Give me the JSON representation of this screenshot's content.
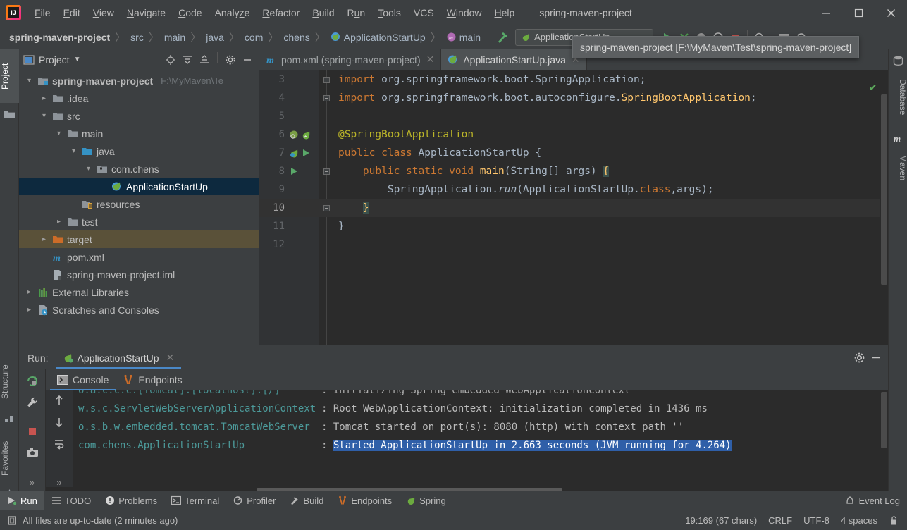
{
  "window": {
    "title": "spring-maven-project",
    "tooltip": "spring-maven-project [F:\\MyMaven\\Test\\spring-maven-project]",
    "minimize": "—",
    "maximize": "❐",
    "close": "✕"
  },
  "menu": [
    {
      "label": "File",
      "mnemonic": "F"
    },
    {
      "label": "Edit",
      "mnemonic": "E"
    },
    {
      "label": "View",
      "mnemonic": "V"
    },
    {
      "label": "Navigate",
      "mnemonic": "N"
    },
    {
      "label": "Code",
      "mnemonic": "C"
    },
    {
      "label": "Analyze",
      "mnemonic": "z"
    },
    {
      "label": "Refactor",
      "mnemonic": "R"
    },
    {
      "label": "Build",
      "mnemonic": "B"
    },
    {
      "label": "Run",
      "mnemonic": "u"
    },
    {
      "label": "Tools",
      "mnemonic": "T"
    },
    {
      "label": "VCS",
      "mnemonic": ""
    },
    {
      "label": "Window",
      "mnemonic": "W"
    },
    {
      "label": "Help",
      "mnemonic": "H"
    }
  ],
  "breadcrumbs": [
    {
      "label": "spring-maven-project",
      "bold": true,
      "icon": "none"
    },
    {
      "label": "src",
      "bold": false,
      "icon": "none"
    },
    {
      "label": "main",
      "bold": false,
      "icon": "none"
    },
    {
      "label": "java",
      "bold": false,
      "icon": "none"
    },
    {
      "label": "com",
      "bold": false,
      "icon": "none"
    },
    {
      "label": "chens",
      "bold": false,
      "icon": "none"
    },
    {
      "label": "ApplicationStartUp",
      "bold": false,
      "icon": "spring-class-icon"
    },
    {
      "label": "main",
      "bold": false,
      "icon": "method-icon"
    }
  ],
  "toolbar": {
    "build_icon": "hammer-icon",
    "run_config_name": "ApplicationStartUp",
    "actions": [
      "run-icon",
      "debug-icon",
      "run-coverage-icon",
      "profile-icon",
      "stop-icon",
      "search-icon",
      "layout-icon",
      "settings-icon"
    ]
  },
  "left_strip": [
    {
      "label": "Project",
      "icon": "folder-icon",
      "selected": true
    },
    {
      "label": "Structure",
      "icon": "structure-icon",
      "selected": false
    },
    {
      "label": "Favorites",
      "icon": "star-icon",
      "selected": false
    }
  ],
  "right_strip": [
    {
      "label": "Database",
      "icon": "database-icon"
    },
    {
      "label": "Maven",
      "icon": "maven-icon"
    }
  ],
  "project_panel": {
    "title": "Project",
    "dropdown_icon": "chevron-down-icon",
    "actions": [
      "locate-icon",
      "expand-all-icon",
      "collapse-all-icon",
      "gear-icon",
      "hide-icon"
    ],
    "tree": [
      {
        "label": "spring-maven-project",
        "path": "F:\\MyMaven\\Te",
        "depth": 0,
        "arrow": "down",
        "icon": "module-icon",
        "bold": true,
        "state": "normal"
      },
      {
        "label": ".idea",
        "path": "",
        "depth": 1,
        "arrow": "right",
        "icon": "folder-icon",
        "bold": false,
        "state": "normal"
      },
      {
        "label": "src",
        "path": "",
        "depth": 1,
        "arrow": "down",
        "icon": "folder-icon",
        "bold": false,
        "state": "normal"
      },
      {
        "label": "main",
        "path": "",
        "depth": 2,
        "arrow": "down",
        "icon": "folder-icon",
        "bold": false,
        "state": "normal"
      },
      {
        "label": "java",
        "path": "",
        "depth": 3,
        "arrow": "down",
        "icon": "source-icon",
        "bold": false,
        "state": "normal"
      },
      {
        "label": "com.chens",
        "path": "",
        "depth": 4,
        "arrow": "down",
        "icon": "package-icon",
        "bold": false,
        "state": "normal"
      },
      {
        "label": "ApplicationStartUp",
        "path": "",
        "depth": 5,
        "arrow": "none",
        "icon": "spring-class-icon",
        "bold": false,
        "state": "selected"
      },
      {
        "label": "resources",
        "path": "",
        "depth": 3,
        "arrow": "none",
        "icon": "resource-icon",
        "bold": false,
        "state": "normal"
      },
      {
        "label": "test",
        "path": "",
        "depth": 2,
        "arrow": "right",
        "icon": "folder-icon",
        "bold": false,
        "state": "normal"
      },
      {
        "label": "target",
        "path": "",
        "depth": 1,
        "arrow": "right",
        "icon": "target-icon",
        "bold": false,
        "state": "highlight"
      },
      {
        "label": "pom.xml",
        "path": "",
        "depth": 1,
        "arrow": "none",
        "icon": "maven-file-icon",
        "bold": false,
        "state": "normal"
      },
      {
        "label": "spring-maven-project.iml",
        "path": "",
        "depth": 1,
        "arrow": "none",
        "icon": "iml-icon",
        "bold": false,
        "state": "normal"
      },
      {
        "label": "External Libraries",
        "path": "",
        "depth": 0,
        "arrow": "right",
        "icon": "library-icon",
        "bold": false,
        "state": "normal"
      },
      {
        "label": "Scratches and Consoles",
        "path": "",
        "depth": 0,
        "arrow": "right",
        "icon": "scratch-icon",
        "bold": false,
        "state": "normal"
      }
    ]
  },
  "editor": {
    "tabs": [
      {
        "label": "pom.xml (spring-maven-project)",
        "icon": "maven-file-icon",
        "active": false,
        "close": "✕"
      },
      {
        "label": "ApplicationStartUp.java",
        "icon": "spring-class-icon",
        "active": true,
        "close": "✕"
      }
    ],
    "inspection_status": "✔",
    "lines": [
      {
        "num": "3",
        "current": false,
        "fold": "collapse",
        "gutter": [],
        "tokens": [
          {
            "t": "import ",
            "c": "kw"
          },
          {
            "t": "org.springframework.boot.SpringApplication",
            "c": "cls"
          },
          {
            "t": ";",
            "c": "br"
          }
        ]
      },
      {
        "num": "4",
        "current": false,
        "fold": "collapse",
        "gutter": [],
        "tokens": [
          {
            "t": "import ",
            "c": "kw"
          },
          {
            "t": "org.springframework.boot.autoconfigure.",
            "c": "cls"
          },
          {
            "t": "SpringBootApplication",
            "c": "fn"
          },
          {
            "t": ";",
            "c": "br"
          }
        ]
      },
      {
        "num": "5",
        "current": false,
        "fold": "none",
        "gutter": [],
        "tokens": []
      },
      {
        "num": "6",
        "current": false,
        "fold": "none",
        "gutter": [
          "bean-icon",
          "spring-leaf-icon"
        ],
        "tokens": [
          {
            "t": "@SpringBootApplication",
            "c": "ann"
          }
        ]
      },
      {
        "num": "7",
        "current": false,
        "fold": "none",
        "gutter": [
          "spring-bean-icon",
          "run-gutter-icon"
        ],
        "tokens": [
          {
            "t": "public class ",
            "c": "kw"
          },
          {
            "t": "ApplicationStartUp",
            "c": "cls"
          },
          {
            "t": " {",
            "c": "br"
          }
        ]
      },
      {
        "num": "8",
        "current": false,
        "fold": "collapse",
        "gutter": [
          "run-gutter-icon"
        ],
        "tokens": [
          {
            "t": "    public static void ",
            "c": "kw"
          },
          {
            "t": "main",
            "c": "fn"
          },
          {
            "t": "(String[] args) ",
            "c": "cls"
          },
          {
            "t": "{",
            "c": "brhl"
          }
        ]
      },
      {
        "num": "9",
        "current": false,
        "fold": "none",
        "gutter": [],
        "tokens": [
          {
            "t": "        SpringApplication.",
            "c": "cls"
          },
          {
            "t": "run",
            "c": "mi"
          },
          {
            "t": "(ApplicationStartUp.",
            "c": "cls"
          },
          {
            "t": "class",
            "c": "kw"
          },
          {
            "t": ",args);",
            "c": "cls"
          }
        ]
      },
      {
        "num": "10",
        "current": true,
        "fold": "collapse",
        "gutter": [],
        "tokens": [
          {
            "t": "    ",
            "c": "cls"
          },
          {
            "t": "}",
            "c": "brhl"
          }
        ]
      },
      {
        "num": "11",
        "current": false,
        "fold": "none",
        "gutter": [],
        "tokens": [
          {
            "t": "}",
            "c": "br"
          }
        ]
      },
      {
        "num": "12",
        "current": false,
        "fold": "none",
        "gutter": [],
        "tokens": []
      }
    ]
  },
  "run_panel": {
    "label": "Run:",
    "config_name": "ApplicationStartUp",
    "config_icon": "spring-run-icon",
    "close": "✕",
    "header_actions": [
      "gear-icon",
      "hide-icon"
    ],
    "tool_buttons": [
      "rerun-icon",
      "wrench-icon",
      "stop-icon",
      "camera-icon",
      "more-icon"
    ],
    "side_buttons": [
      "scroll-up-icon",
      "scroll-down-icon",
      "soft-wrap-icon",
      "more-icon"
    ],
    "console_tabs": [
      {
        "label": "Console",
        "icon": "console-icon",
        "selected": true
      },
      {
        "label": "Endpoints",
        "icon": "endpoints-icon",
        "selected": false
      }
    ],
    "console_lines": [
      {
        "source": "o.a.c.c.c.[Tomcat].[localhost].[/]",
        "message": "Initializing Spring embedded WebApplicationContext",
        "selected": false,
        "partial": true
      },
      {
        "source": "w.s.c.ServletWebServerApplicationContext",
        "message": "Root WebApplicationContext: initialization completed in 1436 ms",
        "selected": false,
        "partial": false
      },
      {
        "source": "o.s.b.w.embedded.tomcat.TomcatWebServer",
        "message": "Tomcat started on port(s): 8080 (http) with context path ''",
        "selected": false,
        "partial": false
      },
      {
        "source": "com.chens.ApplicationStartUp",
        "message": "Started ApplicationStartUp in 2.663 seconds (JVM running for 4.264)",
        "selected": true,
        "partial": false
      }
    ]
  },
  "bottom_bar": {
    "tabs": [
      {
        "label": "Run",
        "icon": "run-small-icon",
        "selected": true
      },
      {
        "label": "TODO",
        "icon": "todo-icon",
        "selected": false
      },
      {
        "label": "Problems",
        "icon": "problems-icon",
        "selected": false
      },
      {
        "label": "Terminal",
        "icon": "terminal-icon",
        "selected": false
      },
      {
        "label": "Profiler",
        "icon": "profiler-icon",
        "selected": false
      },
      {
        "label": "Build",
        "icon": "hammer-icon",
        "selected": false
      },
      {
        "label": "Endpoints",
        "icon": "endpoints-icon",
        "selected": false
      },
      {
        "label": "Spring",
        "icon": "spring-leaf-icon",
        "selected": false
      }
    ],
    "event_log": {
      "label": "Event Log",
      "icon": "bell-icon"
    }
  },
  "status_bar": {
    "message": "All files are up-to-date (2 minutes ago)",
    "message_icon": "sync-icon",
    "caret": "19:169 (67 chars)",
    "line_separator": "CRLF",
    "encoding": "UTF-8",
    "indent": "4 spaces",
    "lock_icon": "unlocked-icon"
  },
  "colors": {
    "bg_panel": "#3c3f41",
    "bg_editor": "#2b2b2b",
    "accent_blue": "#4a88c7",
    "selection_blue": "#2f5fa8",
    "tree_selection": "#0d293e",
    "keyword_orange": "#cc7832",
    "annotation_yellow": "#bbb529",
    "method_yellow": "#ffc66d",
    "console_cyan": "#4c9a9a",
    "green_ok": "#5ba65b"
  }
}
